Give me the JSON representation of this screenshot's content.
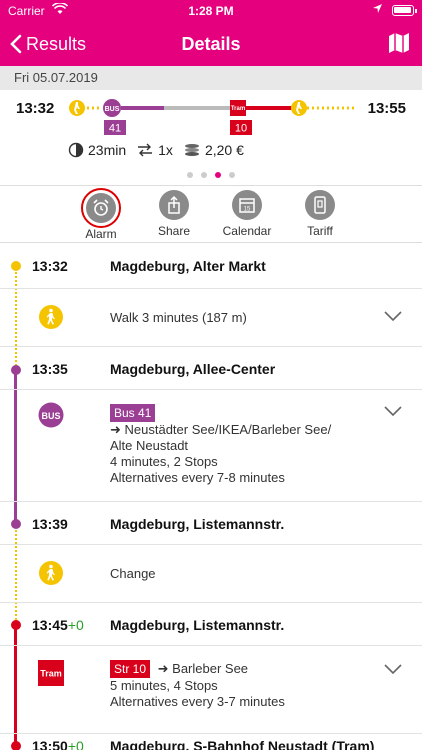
{
  "status_bar": {
    "carrier": "Carrier",
    "time": "1:28 PM"
  },
  "nav": {
    "back_label": "Results",
    "title": "Details"
  },
  "date": "Fri 05.07.2019",
  "summary": {
    "departure": "13:32",
    "arrival": "13:55",
    "bus_line": "41",
    "tram_line": "10",
    "bus_label": "BUS",
    "tram_label": "Tram",
    "duration": "23min",
    "changes": "1x",
    "price": "2,20 €",
    "page_count": 4,
    "active_page": 3
  },
  "actions": [
    {
      "label": "Alarm",
      "icon": "alarm-clock-icon"
    },
    {
      "label": "Share",
      "icon": "share-icon"
    },
    {
      "label": "Calendar",
      "icon": "calendar-icon"
    },
    {
      "label": "Tariff",
      "icon": "tariff-icon"
    }
  ],
  "timeline": {
    "stop1": {
      "time": "13:32",
      "name": "Magdeburg, Alter Markt"
    },
    "walk1": {
      "text": "Walk 3 minutes (187 m)"
    },
    "stop2": {
      "time": "13:35",
      "name": "Magdeburg, Allee-Center"
    },
    "bus": {
      "line": "Bus 41",
      "icon_label": "BUS",
      "direction_line1": "➜ Neustädter See/IKEA/Barleber See/",
      "direction_line2": "Alte Neustadt",
      "duration": "4 minutes, 2 Stops",
      "alternatives": "Alternatives every 7-8 minutes"
    },
    "stop3": {
      "time": "13:39",
      "name": "Magdeburg, Listemannstr."
    },
    "change": {
      "text": "Change"
    },
    "stop4": {
      "time": "13:45",
      "delay": "+0",
      "name": "Magdeburg, Listemannstr."
    },
    "tram": {
      "line": "Str 10",
      "icon_label": "Tram",
      "direction": "➜ Barleber See",
      "duration": "5 minutes, 4 Stops",
      "alternatives": "Alternatives every 3-7 minutes"
    },
    "stop5": {
      "time": "13:50",
      "delay": "+0",
      "name": "Magdeburg, S-Bahnhof Neustadt (Tram)"
    }
  },
  "colors": {
    "brand": "#e5007e",
    "walk": "#f5c400",
    "bus": "#9b3f95",
    "tram": "#d8001a"
  }
}
